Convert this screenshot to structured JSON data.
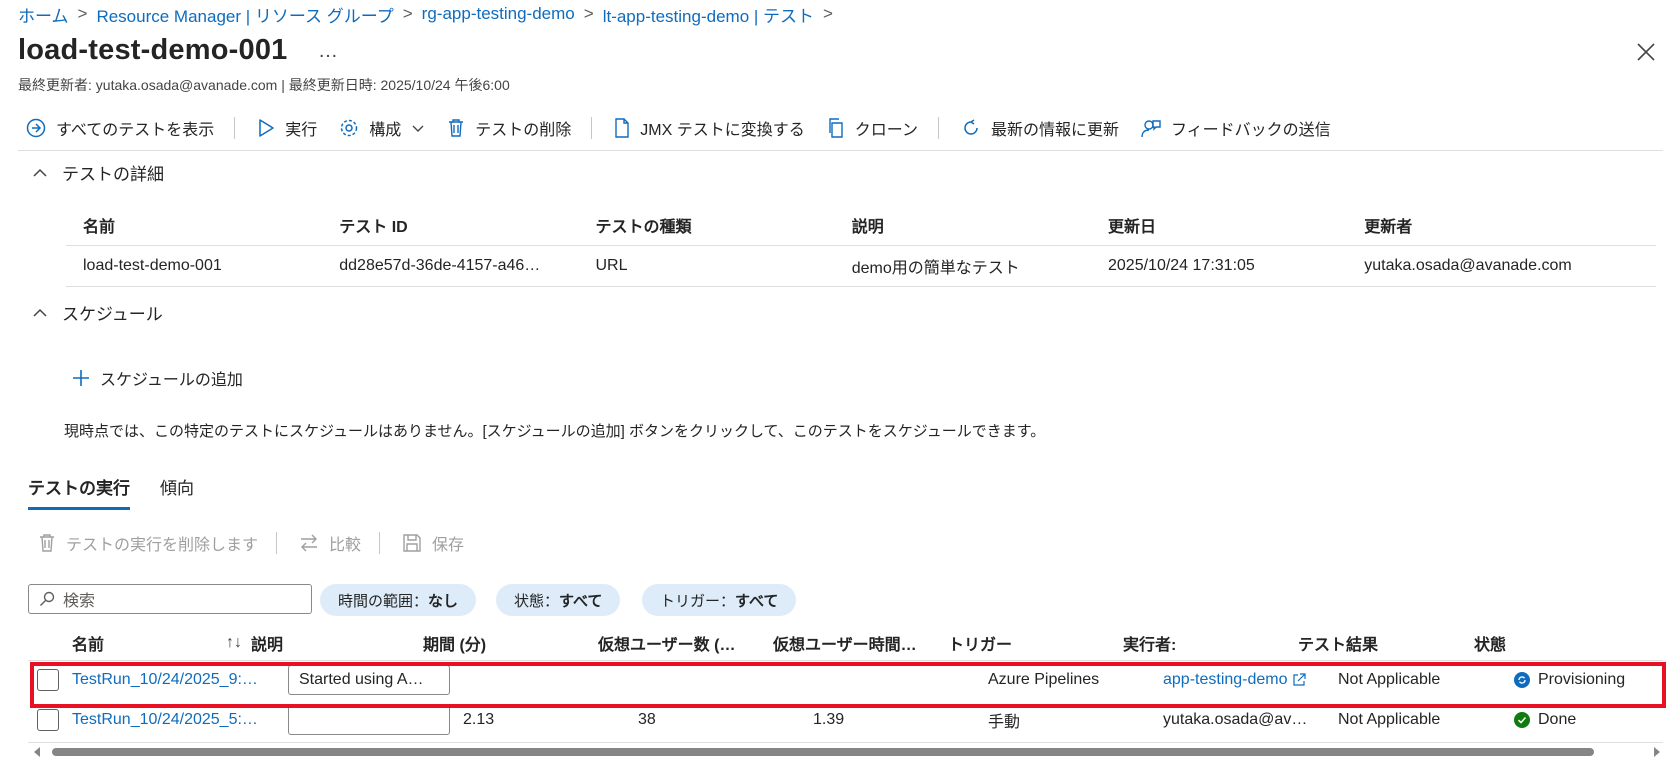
{
  "breadcrumb": {
    "items": [
      "ホーム",
      "Resource Manager | リソース グループ",
      "rg-app-testing-demo",
      "lt-app-testing-demo | テスト"
    ]
  },
  "header": {
    "title": "load-test-demo-001",
    "more_label": "…",
    "subtitle": "最終更新者: yutaka.osada@avanade.com | 最終更新日時: 2025/10/24 午後6:00"
  },
  "toolbar": {
    "show_all": "すべてのテストを表示",
    "run": "実行",
    "configure": "構成",
    "delete": "テストの削除",
    "convert_jmx": "JMX テストに変換する",
    "clone": "クローン",
    "refresh": "最新の情報に更新",
    "feedback": "フィードバックの送信"
  },
  "details": {
    "section_title": "テストの詳細",
    "columns": [
      "名前",
      "テスト ID",
      "テストの種類",
      "説明",
      "更新日",
      "更新者"
    ],
    "row": [
      "load-test-demo-001",
      "dd28e57d-36de-4157-a46…",
      "URL",
      "demo用の簡単なテスト",
      "2025/10/24 17:31:05",
      "yutaka.osada@avanade.com"
    ]
  },
  "schedule": {
    "section_title": "スケジュール",
    "add_label": "スケジュールの追加",
    "message": "現時点では、この特定のテストにスケジュールはありません。[スケジュールの追加] ボタンをクリックして、このテストをスケジュールできます。"
  },
  "tabs": {
    "runs": "テストの実行",
    "trends": "傾向"
  },
  "runs_toolbar": {
    "delete": "テストの実行を削除します",
    "compare": "比較",
    "save": "保存"
  },
  "filters": {
    "search_placeholder": "検索",
    "time_label": "時間の範囲：",
    "time_value": "なし",
    "state_label": "状態：",
    "state_value": "すべて",
    "trigger_label": "トリガー：",
    "trigger_value": "すべて"
  },
  "runs_grid": {
    "columns": [
      "名前",
      "説明",
      "期間 (分)",
      "仮想ユーザー数 (…",
      "仮想ユーザー時間…",
      "トリガー",
      "実行者:",
      "テスト結果",
      "状態"
    ],
    "rows": [
      {
        "name": "TestRun_10/24/2025_9:…",
        "description": "Started using A…",
        "duration": "",
        "vusers": "",
        "vuser_hours": "",
        "trigger": "Azure Pipelines",
        "executor": "app-testing-demo",
        "result": "Not Applicable",
        "status": "Provisioning"
      },
      {
        "name": "TestRun_10/24/2025_5:…",
        "description": "",
        "duration": "2.13",
        "vusers": "38",
        "vuser_hours": "1.39",
        "trigger": "手動",
        "executor": "yutaka.osada@av…",
        "result": "Not Applicable",
        "status": "Done"
      }
    ]
  },
  "colors": {
    "link": "#0f6cbd",
    "highlight": "#e81123",
    "provisioning": "#0f6cbd",
    "done": "#107c10"
  }
}
